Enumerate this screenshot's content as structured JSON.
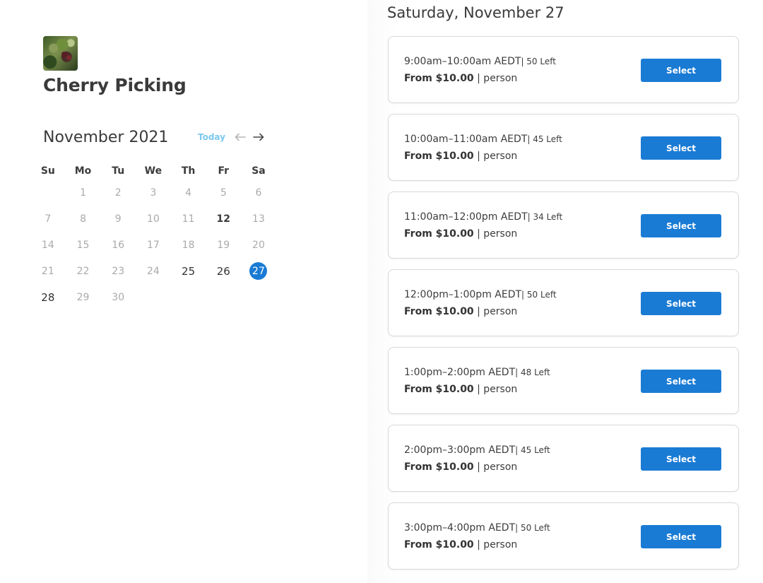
{
  "product": {
    "title": "Cherry Picking",
    "image_icon": "cherry-photo"
  },
  "calendar": {
    "month_label": "November 2021",
    "today_label": "Today",
    "prev_icon": "arrow-left-icon",
    "next_icon": "arrow-right-icon",
    "weekdays": [
      "Su",
      "Mo",
      "Tu",
      "We",
      "Th",
      "Fr",
      "Sa"
    ],
    "weeks": [
      [
        "",
        "1",
        "2",
        "3",
        "4",
        "5",
        "6"
      ],
      [
        "7",
        "8",
        "9",
        "10",
        "11",
        "12",
        "13"
      ],
      [
        "14",
        "15",
        "16",
        "17",
        "18",
        "19",
        "20"
      ],
      [
        "21",
        "22",
        "23",
        "24",
        "25",
        "26",
        "27"
      ],
      [
        "28",
        "29",
        "30",
        "",
        "",
        "",
        ""
      ]
    ],
    "selected_day": "27",
    "available_days": [
      "25",
      "26",
      "27",
      "28"
    ],
    "today_day": "12",
    "accent_color": "#1a7bd4"
  },
  "schedule": {
    "date_heading": "Saturday, November 27",
    "slots": [
      {
        "time": "9:00am–10:00am AEDT",
        "left": "| 50 Left",
        "from": "From $10.00",
        "unit": " | person",
        "button": "Select"
      },
      {
        "time": "10:00am–11:00am AEDT",
        "left": "| 45 Left",
        "from": "From $10.00",
        "unit": " | person",
        "button": "Select"
      },
      {
        "time": "11:00am–12:00pm AEDT",
        "left": "| 34 Left",
        "from": "From $10.00",
        "unit": " | person",
        "button": "Select"
      },
      {
        "time": "12:00pm–1:00pm AEDT",
        "left": "| 50 Left",
        "from": "From $10.00",
        "unit": " | person",
        "button": "Select"
      },
      {
        "time": "1:00pm–2:00pm AEDT",
        "left": "| 48 Left",
        "from": "From $10.00",
        "unit": " | person",
        "button": "Select"
      },
      {
        "time": "2:00pm–3:00pm AEDT",
        "left": "| 45 Left",
        "from": "From $10.00",
        "unit": " | person",
        "button": "Select"
      },
      {
        "time": "3:00pm–4:00pm AEDT",
        "left": "| 50 Left",
        "from": "From $10.00",
        "unit": " | person",
        "button": "Select"
      }
    ]
  }
}
